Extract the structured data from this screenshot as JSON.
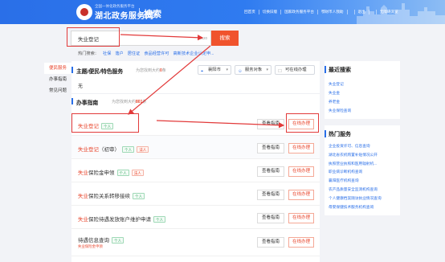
{
  "header": {
    "site_small": "全国一体化政务服务平台",
    "site_name": "湖北政务服务网",
    "page_title": "搜索",
    "nav": [
      "回首页",
      "切换旧版",
      "国家政务服务平台",
      "鄂财币人我助",
      "",
      "退出",
      "",
      "无障碍浏览"
    ]
  },
  "search": {
    "value": "失业登记",
    "count": "4/120",
    "button": "搜索",
    "hot_label": "热门搜索：",
    "hot_keywords": [
      "社保",
      "落户",
      "居住证",
      "食品经营许可",
      "高新技术企业认定申..."
    ]
  },
  "leftnav": [
    "便民服务",
    "办事指南",
    "常见问题"
  ],
  "topic": {
    "title": "主题/便民/特色服务",
    "sub_prefix": "为您找到大约",
    "sub_count": "0",
    "sub_suffix": "条",
    "region": "襄阳市",
    "audience": "服务对象",
    "online_only": "可在线办理",
    "empty": "无"
  },
  "guide": {
    "title": "办事指南",
    "sub_prefix": "为您找到大约",
    "sub_count": "801",
    "sub_suffix": "条",
    "rows": [
      {
        "red": "失业登记",
        "rest": "",
        "tags": [
          "个人"
        ],
        "meta": ""
      },
      {
        "red": "失业登记",
        "rest": "（初审）",
        "tags": [
          "个人",
          "法人"
        ],
        "meta": ""
      },
      {
        "red": "失业",
        "rest": "保险金申领",
        "tags": [
          "个人",
          "法人"
        ],
        "meta": ""
      },
      {
        "red": "失业",
        "rest": "保险关系转移接续",
        "tags": [
          "个人"
        ],
        "meta": ""
      },
      {
        "red": "失业",
        "rest": "保险待遇发放账户维护申请",
        "tags": [
          "个人"
        ],
        "meta": ""
      },
      {
        "red": "",
        "rest": "待遇信息查询",
        "tags": [
          "个人"
        ],
        "meta": "失业保险金申领"
      }
    ],
    "btn_guide": "查看指南",
    "btn_online": "在线办理"
  },
  "recent": {
    "title": "最近搜索",
    "items": [
      "失业登记",
      "失业金",
      "养老金",
      "失业保险查询"
    ]
  },
  "hot": {
    "title": "热门服务",
    "items": [
      "企业投资许可、信息查询",
      "湖北省农机购置补贴情况公开",
      "执照营业执照和医用辐射机...",
      "职业病诊断机构查询",
      "襄阳医疗机构查询",
      "农产品质量安全监测机构查询",
      "个人健康档案随访执业情况查询",
      "母婴保健技术服务机构查询"
    ]
  },
  "colors": {
    "brand": "#2a6fe8",
    "accent": "#f0532d",
    "annotation": "#e23a3a"
  }
}
